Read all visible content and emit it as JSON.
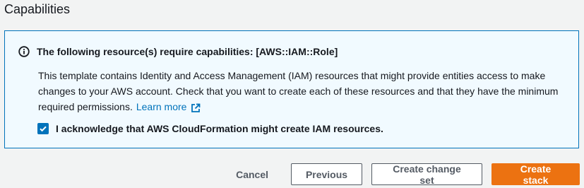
{
  "section": {
    "title": "Capabilities"
  },
  "alert": {
    "heading": "The following resource(s) require capabilities: [AWS::IAM::Role]",
    "body": "This template contains Identity and Access Management (IAM) resources that might provide entities access to make changes to your AWS account. Check that you want to create each of these resources and that they have the minimum required permissions.",
    "learn_more": "Learn more",
    "acknowledge": "I acknowledge that AWS CloudFormation might create IAM resources.",
    "acknowledge_checked": true
  },
  "actions": {
    "cancel": "Cancel",
    "previous": "Previous",
    "create_change_set": "Create change set",
    "create_stack": "Create stack"
  },
  "colors": {
    "info_border": "#0073bb",
    "info_background": "#f1faff",
    "primary_button": "#ec7211",
    "link": "#0073bb"
  },
  "icons": [
    "info-icon",
    "external-link-icon",
    "checkmark-icon"
  ]
}
